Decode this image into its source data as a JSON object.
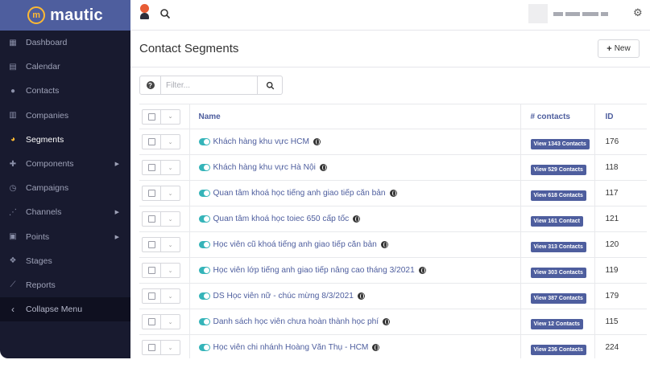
{
  "app": {
    "logo_mark": "m",
    "logo_text": "mautic",
    "colors": {
      "sidebar_bg": "#181a2f",
      "logo_bg": "#4e5e9e",
      "accent": "#fdb933",
      "link": "#4e5e9e",
      "toggle_on": "#35b4b9"
    }
  },
  "sidebar": {
    "items": [
      {
        "label": "Dashboard",
        "icon": "dashboard-icon",
        "glyph": "▦",
        "active": false,
        "submenu": false
      },
      {
        "label": "Calendar",
        "icon": "calendar-icon",
        "glyph": "▤",
        "active": false,
        "submenu": false
      },
      {
        "label": "Contacts",
        "icon": "user-icon",
        "glyph": "●",
        "active": false,
        "submenu": false
      },
      {
        "label": "Companies",
        "icon": "building-icon",
        "glyph": "▥",
        "active": false,
        "submenu": false
      },
      {
        "label": "Segments",
        "icon": "pie-chart-icon",
        "glyph": "◕",
        "active": true,
        "submenu": false
      },
      {
        "label": "Components",
        "icon": "puzzle-icon",
        "glyph": "✚",
        "active": false,
        "submenu": true
      },
      {
        "label": "Campaigns",
        "icon": "clock-icon",
        "glyph": "◷",
        "active": false,
        "submenu": false
      },
      {
        "label": "Channels",
        "icon": "rss-icon",
        "glyph": "⋰",
        "active": false,
        "submenu": true
      },
      {
        "label": "Points",
        "icon": "calculator-icon",
        "glyph": "▣",
        "active": false,
        "submenu": true
      },
      {
        "label": "Stages",
        "icon": "stages-icon",
        "glyph": "❖",
        "active": false,
        "submenu": false
      },
      {
        "label": "Reports",
        "icon": "line-chart-icon",
        "glyph": "⟋",
        "active": false,
        "submenu": false
      }
    ],
    "collapse_label": "Collapse Menu"
  },
  "header": {
    "page_title": "Contact Segments",
    "new_button_label": "New"
  },
  "filter": {
    "placeholder": "Filter...",
    "value": ""
  },
  "table": {
    "columns": {
      "name": "Name",
      "contacts": "# contacts",
      "id": "ID"
    },
    "rows": [
      {
        "name": "Khách hàng khu vực HCM",
        "contacts_label": "View 1343 Contacts",
        "id": "176"
      },
      {
        "name": "Khách hàng khu vực Hà Nội",
        "contacts_label": "View 529 Contacts",
        "id": "118"
      },
      {
        "name": "Quan tâm khoá học tiếng anh giao tiếp căn bản",
        "contacts_label": "View 618 Contacts",
        "id": "117"
      },
      {
        "name": "Quan tâm khoá học toiec 650 cấp tốc",
        "contacts_label": "View 161 Contact",
        "id": "121"
      },
      {
        "name": "Học viên cũ khoá tiếng anh giao tiếp căn bản",
        "contacts_label": "View 313 Contacts",
        "id": "120"
      },
      {
        "name": "Học viên lớp tiếng anh giao tiếp nâng cao tháng 3/2021",
        "contacts_label": "View 303 Contacts",
        "id": "119"
      },
      {
        "name": "DS Học viên nữ - chúc mừng 8/3/2021",
        "contacts_label": "View 387 Contacts",
        "id": "179"
      },
      {
        "name": "Danh sách học viên chưa hoàn thành học phí",
        "contacts_label": "View 12 Contacts",
        "id": "115"
      },
      {
        "name": "Học viên chi nhánh Hoàng Văn Thụ - HCM",
        "contacts_label": "View 236 Contacts",
        "id": "224"
      }
    ]
  }
}
